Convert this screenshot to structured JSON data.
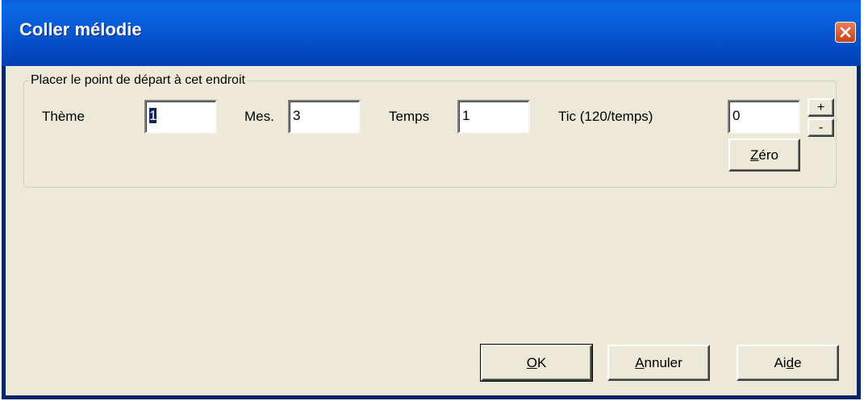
{
  "window": {
    "title": "Coller mélodie"
  },
  "group": {
    "legend": "Placer le point de départ à cet endroit"
  },
  "fields": {
    "theme": {
      "label": "Thème",
      "value": "1"
    },
    "mes": {
      "label": "Mes.",
      "value": "3"
    },
    "temps": {
      "label": "Temps",
      "value": "1"
    },
    "tic": {
      "label": "Tic (120/temps)",
      "value": "0"
    }
  },
  "buttons": {
    "plus": "+",
    "minus": "-",
    "zero_accel": "Z",
    "zero_rest": "éro",
    "ok_accel": "O",
    "ok_rest": "K",
    "annuler_accel": "A",
    "annuler_rest": "nnuler",
    "aide_pre": "Ai",
    "aide_accel": "d",
    "aide_post": "e"
  },
  "icons": {
    "close": "close-x-icon"
  },
  "colors": {
    "titlebar": "#0654cf",
    "client_bg": "#ece9d8",
    "close_bg": "#c4411c",
    "selection": "#0a246a"
  }
}
